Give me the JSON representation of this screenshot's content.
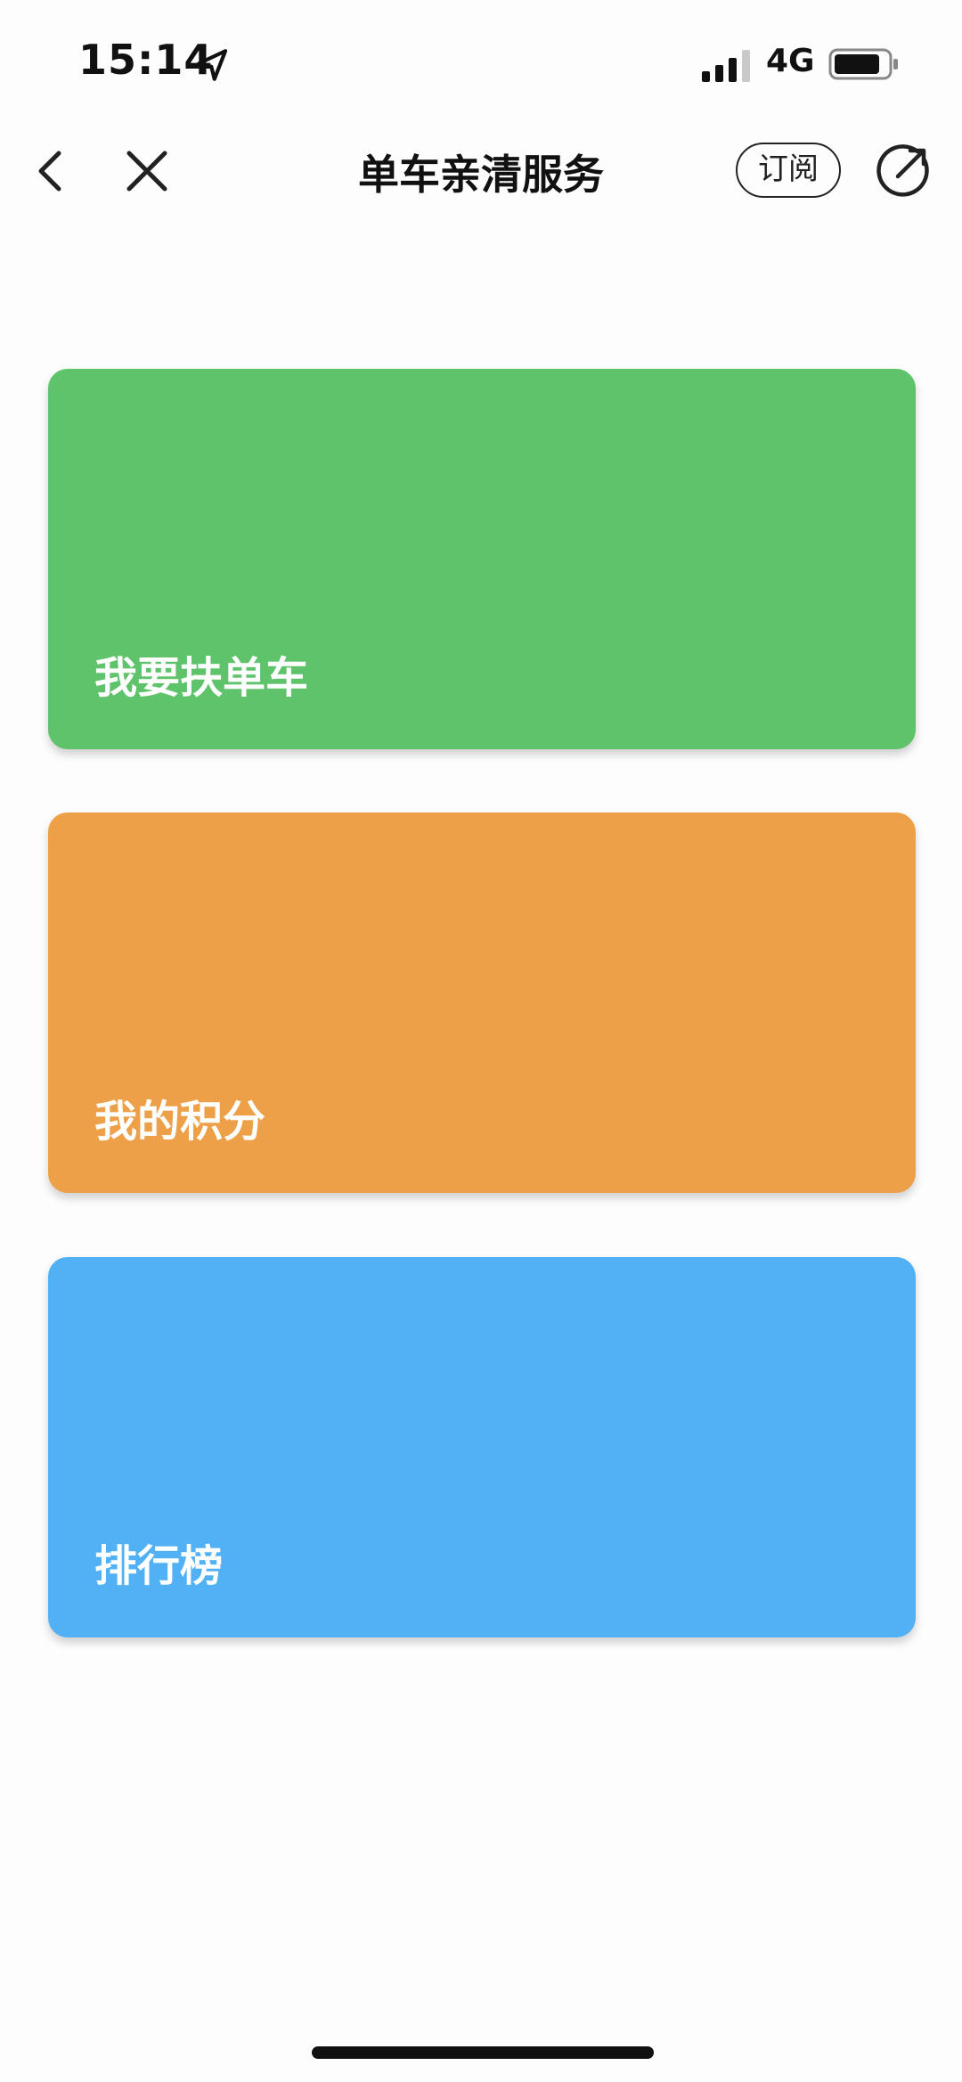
{
  "status_bar": {
    "time": "15:14",
    "location_icon": "location-arrow-icon",
    "signal_icon": "cellular-signal-icon",
    "network": "4G",
    "battery_icon": "battery-icon"
  },
  "nav": {
    "back_icon": "chevron-left-icon",
    "close_icon": "close-icon",
    "title": "单车亲清服务",
    "subscribe_label": "订阅",
    "share_icon": "share-icon"
  },
  "cards": [
    {
      "label": "我要扶单车",
      "color": "#5ec36b"
    },
    {
      "label": "我的积分",
      "color": "#eda048"
    },
    {
      "label": "排行榜",
      "color": "#52b0f5"
    }
  ]
}
